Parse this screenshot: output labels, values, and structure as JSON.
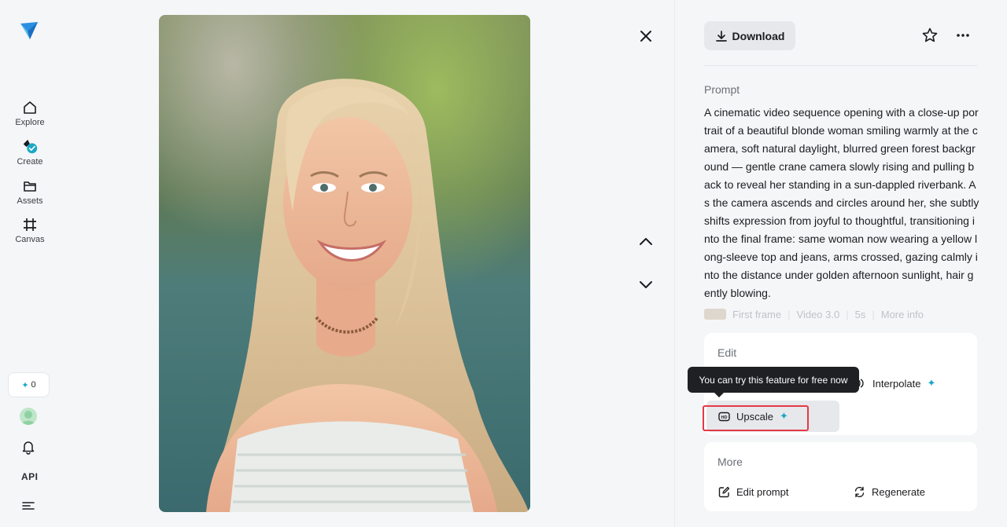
{
  "sidebar": {
    "items": [
      {
        "label": "Explore",
        "icon": "home-icon"
      },
      {
        "label": "Create",
        "icon": "create-icon"
      },
      {
        "label": "Assets",
        "icon": "folder-icon"
      },
      {
        "label": "Canvas",
        "icon": "canvas-icon"
      }
    ],
    "credits": "0",
    "api_label": "API"
  },
  "header": {
    "download_label": "Download"
  },
  "prompt": {
    "label": "Prompt",
    "text": "A cinematic video sequence opening with a close-up portrait of a beautiful blonde woman smiling warmly at the camera, soft natural daylight, blurred green forest background — gentle crane camera slowly rising and pulling back to reveal her standing in a sun-dappled riverbank. As the camera ascends and circles around her, she subtly shifts expression from joyful to thoughtful, transitioning into the final frame: same woman now wearing a yellow long-sleeve top and jeans, arms crossed, gazing calmly into the distance under golden afternoon sunlight, hair gently blowing.",
    "meta": [
      "First frame",
      "Video 3.0",
      "5s",
      "More info"
    ]
  },
  "edit_card": {
    "title": "Edit",
    "interpolate_label": "Interpolate",
    "upscale_label": "Upscale",
    "tooltip": "You can try this feature for free now"
  },
  "more_card": {
    "title": "More",
    "edit_prompt_label": "Edit prompt",
    "regenerate_label": "Regenerate"
  },
  "colors": {
    "accent": "#1aa8c4",
    "highlight": "#e53945",
    "tooltip_bg": "#1f2023"
  }
}
